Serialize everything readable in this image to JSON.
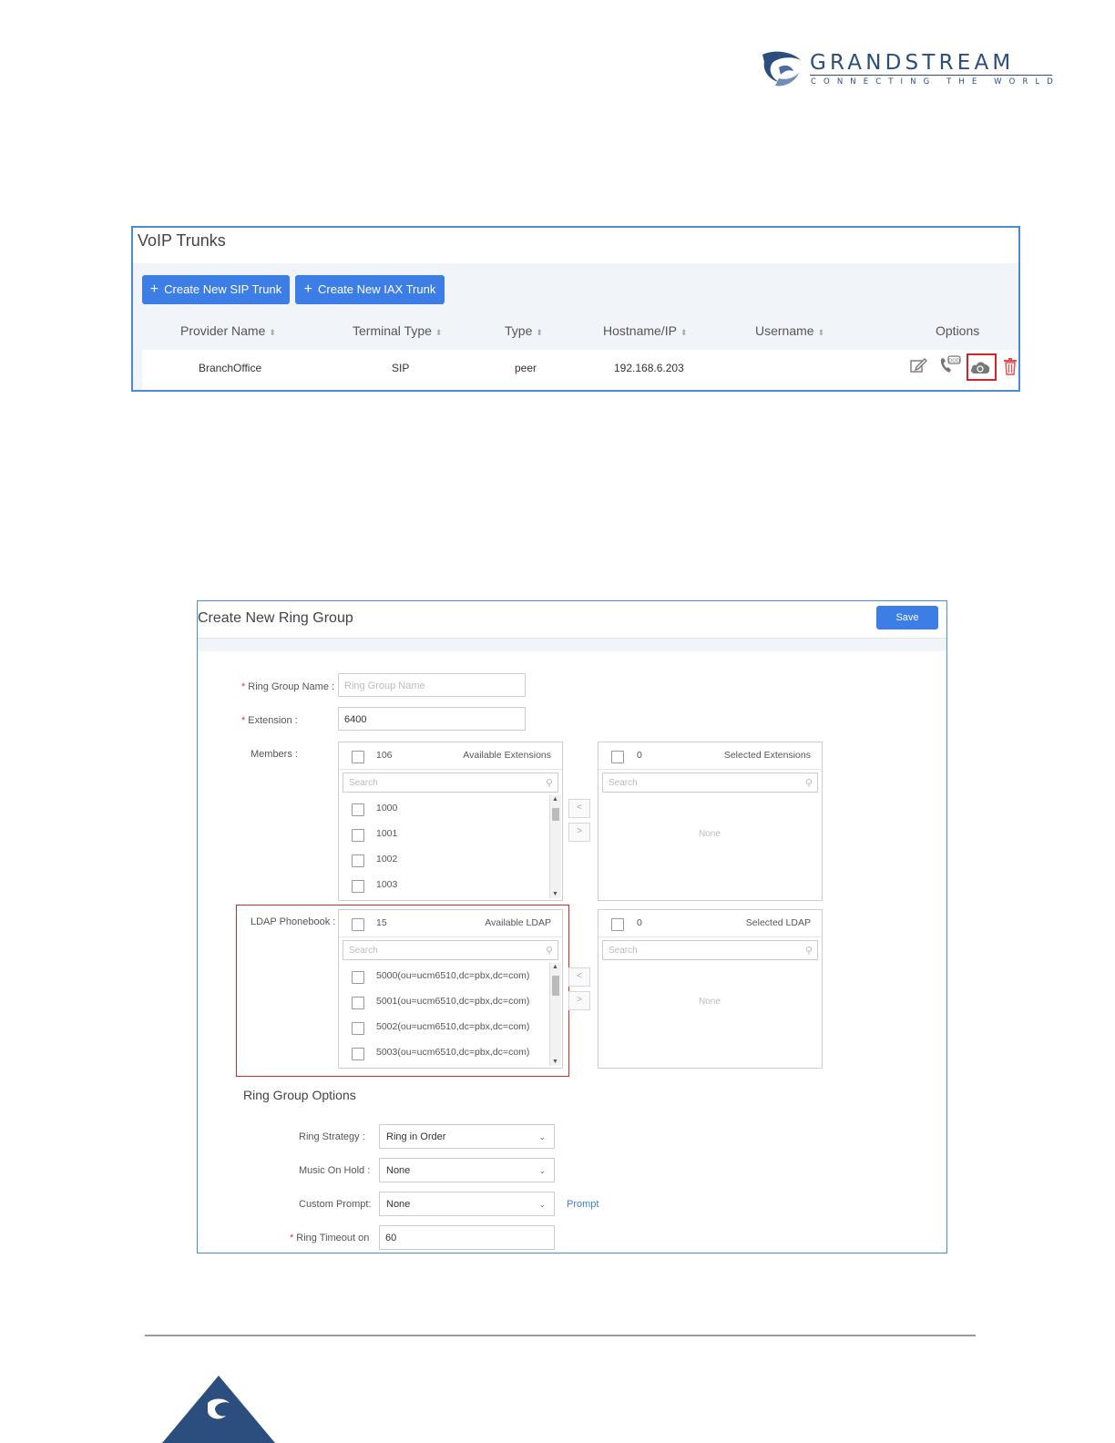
{
  "logo": {
    "word": "GRANDSTREAM",
    "tagline": "CONNECTING THE WORLD",
    "brand_color": "#2b4e7e"
  },
  "voip": {
    "title": "VoIP Trunks",
    "btn_sip": "Create New SIP Trunk",
    "btn_iax": "Create New IAX Trunk",
    "columns": [
      "Provider Name",
      "Terminal Type",
      "Type",
      "Hostname/IP",
      "Username",
      "Options"
    ],
    "row": {
      "provider": "BranchOffice",
      "terminal": "SIP",
      "type": "peer",
      "host": "192.168.6.203",
      "username": ""
    },
    "options_icons": [
      "edit-icon",
      "dod-phone-icon",
      "cloud-sync-icon",
      "trash-icon"
    ]
  },
  "rg": {
    "title": "Create New Ring Group",
    "save": "Save",
    "name_label": "Ring Group Name :",
    "name_placeholder": "Ring Group Name",
    "ext_label": "Extension :",
    "ext_value": "6400",
    "members_label": "Members :",
    "avail_count": "106",
    "avail_label": "Available Extensions",
    "sel_count": "0",
    "sel_label": "Selected Extensions",
    "search": "Search",
    "ext_items": [
      "1000",
      "1001",
      "1002",
      "1003"
    ],
    "none": "None",
    "ldap_label": "LDAP Phonebook :",
    "ldap_avail_count": "15",
    "ldap_avail_label": "Available LDAP",
    "ldap_sel_count": "0",
    "ldap_sel_label": "Selected LDAP",
    "ldap_items": [
      "5000(ou=ucm6510,dc=pbx,dc=com)",
      "5001(ou=ucm6510,dc=pbx,dc=com)",
      "5002(ou=ucm6510,dc=pbx,dc=com)",
      "5003(ou=ucm6510,dc=pbx,dc=com)"
    ],
    "options_title": "Ring Group Options",
    "strategy_label": "Ring Strategy :",
    "strategy_value": "Ring in Order",
    "moh_label": "Music On Hold :",
    "moh_value": "None",
    "prompt_label": "Custom Prompt:",
    "prompt_value": "None",
    "prompt_link": "Prompt",
    "timeout_label": "Ring Timeout on",
    "timeout_value": "60"
  },
  "colors": {
    "accent": "#3d7ee6",
    "highlight_red": "#c9302c"
  }
}
